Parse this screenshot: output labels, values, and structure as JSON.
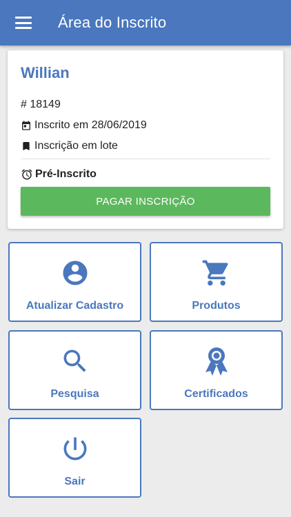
{
  "appbar": {
    "title": "Área do Inscrito",
    "menu_icon": "menu-icon"
  },
  "registrant": {
    "name": "Willian",
    "id_text": "# 18149",
    "registered_text": "Inscrito em 28/06/2019",
    "type_text": "Inscrição em lote",
    "status_text": "Pré-Inscrito",
    "pay_button_label": "PAGAR INSCRIÇÃO"
  },
  "tiles": [
    {
      "label": "Atualizar Cadastro",
      "icon": "account-icon"
    },
    {
      "label": "Produtos",
      "icon": "cart-icon"
    },
    {
      "label": "Pesquisa",
      "icon": "search-icon"
    },
    {
      "label": "Certificados",
      "icon": "award-icon"
    },
    {
      "label": "Sair",
      "icon": "power-icon"
    }
  ],
  "colors": {
    "primary": "#4a77bd",
    "success": "#5cb85c",
    "background": "#ececec"
  }
}
